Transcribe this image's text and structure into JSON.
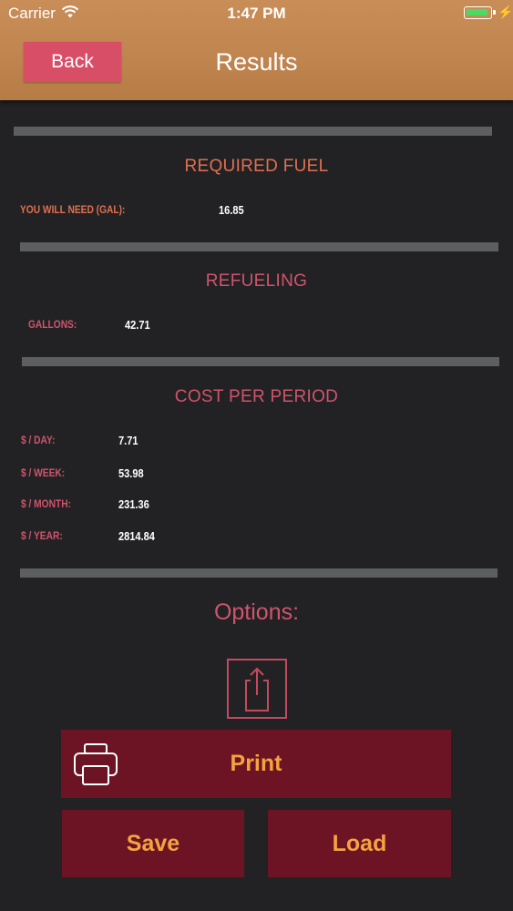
{
  "status_bar": {
    "carrier": "Carrier",
    "time": "1:47 PM"
  },
  "nav": {
    "back_label": "Back",
    "title": "Results"
  },
  "required_fuel": {
    "title": "REQUIRED FUEL",
    "label": "YOU WILL NEED (GAL):",
    "value": "16.85"
  },
  "refueling": {
    "title": "REFUELING",
    "label": "GALLONS:",
    "value": "42.71"
  },
  "cost_per_period": {
    "title": "COST PER PERIOD",
    "rows": [
      {
        "label": "$ / DAY:",
        "value": "7.71"
      },
      {
        "label": "$ / WEEK:",
        "value": "53.98"
      },
      {
        "label": "$ / MONTH:",
        "value": "231.36"
      },
      {
        "label": "$ / YEAR:",
        "value": "2814.84"
      }
    ]
  },
  "options": {
    "title": "Options:",
    "print_label": "Print",
    "save_label": "Save",
    "load_label": "Load"
  },
  "colors": {
    "nav_bar": "#c0844f",
    "back_button": "#d94e67",
    "background": "#222224",
    "divider": "#5d5e60",
    "accent_pink": "#d0546c",
    "required_fuel_title": "#e0704f",
    "button_bg": "#6c1424",
    "button_text": "#f4a340",
    "battery": "#4cd964"
  },
  "icons": [
    "wifi-icon",
    "battery-icon",
    "charging-bolt-icon",
    "share-icon",
    "printer-icon"
  ]
}
